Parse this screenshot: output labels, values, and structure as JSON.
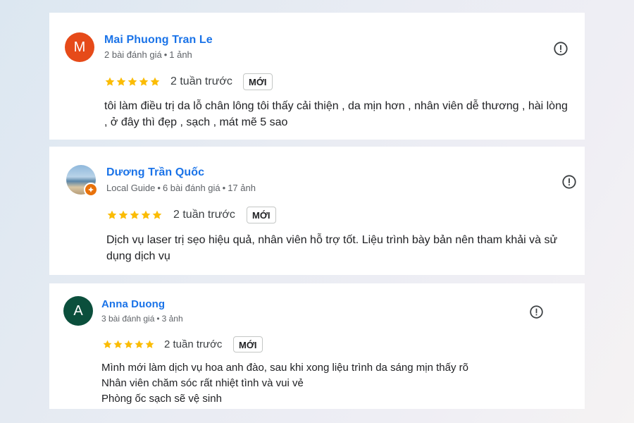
{
  "reviews": [
    {
      "name": "Mai Phuong Tran Le",
      "avatar_letter": "M",
      "meta": [
        "2 bài đánh giá",
        "1 ảnh"
      ],
      "rating": 5,
      "time": "2 tuần trước",
      "badge": "MỚI",
      "text_lines": [
        "tôi làm điều trị da lỗ chân lông tôi thấy cải thiện , da mịn hơn , nhân viên dễ thương , hài lòng",
        ", ở đây thì đẹp , sạch , mát mẽ 5 sao"
      ]
    },
    {
      "name": "Dương Trần Quốc",
      "avatar_letter": "",
      "meta": [
        "Local Guide",
        "6 bài đánh giá",
        "17 ảnh"
      ],
      "rating": 5,
      "time": "2 tuần trước",
      "badge": "MỚI",
      "text_lines": [
        "Dịch vụ laser trị sẹo hiệu quả, nhân viên hỗ trợ tốt. Liệu trình bày bản nên tham khải và sử",
        "dụng dịch vụ"
      ]
    },
    {
      "name": "Anna Duong",
      "avatar_letter": "A",
      "meta": [
        "3 bài đánh giá",
        "3 ảnh"
      ],
      "rating": 5,
      "time": "2 tuần trước",
      "badge": "MỚI",
      "text_lines": [
        "Mình mới làm dịch vụ hoa anh đào, sau khi xong liệu trình da sáng mịn thấy rõ",
        "Nhân viên chăm sóc rất nhiệt tình và vui vẻ",
        "Phòng ốc sạch sẽ vệ sinh"
      ]
    }
  ],
  "meta_separator": "•",
  "colors": {
    "name": "#1a73e8",
    "star": "#fbbc04",
    "avatar_m": "#e64a19",
    "avatar_a": "#0b4f3c",
    "local_guide_badge": "#e8710a"
  },
  "icons": {
    "star": "star-icon",
    "flag": "report-icon",
    "local_guide": "local-guide-icon"
  }
}
